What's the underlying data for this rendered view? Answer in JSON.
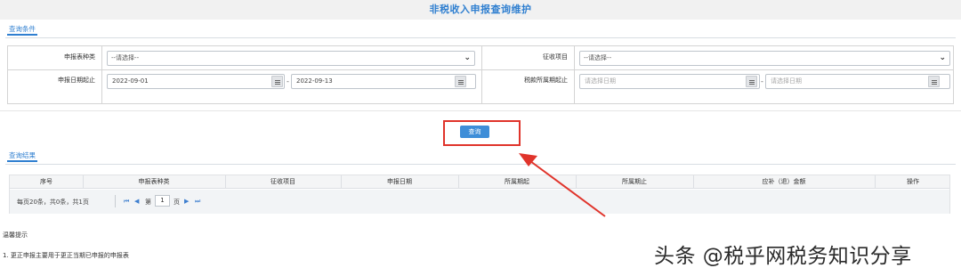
{
  "page": {
    "title": "非税收入申报查询维护"
  },
  "query_section": {
    "tab_label": "查询条件"
  },
  "form": {
    "report_type": {
      "label": "申报表种类",
      "value": "--请选择--"
    },
    "collection_item": {
      "label": "征收项目",
      "value": "--请选择--"
    },
    "report_date": {
      "label": "申报日期起止",
      "start": "2022-09-01",
      "end": "2022-09-13",
      "separator": "-"
    },
    "tax_period": {
      "label": "税款所属期起止",
      "start_placeholder": "请选择日期",
      "end_placeholder": "请选择日期",
      "separator": "-"
    }
  },
  "query_button": {
    "label": "查询"
  },
  "results_section": {
    "tab_label": "查询结果",
    "columns": [
      "序号",
      "申报表种类",
      "征收项目",
      "申报日期",
      "所属期起",
      "所属期止",
      "应补（退）金额",
      "操作"
    ],
    "rows": []
  },
  "pager": {
    "summary": "每页20条，共0条，共1页",
    "page_prefix": "第",
    "current_page": "1",
    "page_suffix": "页",
    "icons": [
      "first-page-icon",
      "prev-page-icon",
      "next-page-icon",
      "last-page-icon"
    ]
  },
  "tips": {
    "title": "温馨提示",
    "items": [
      "1. 更正申报主要用于更正当期已申报的申报表"
    ]
  },
  "watermark": "头条 @税乎网税务知识分享",
  "colors": {
    "accent": "#2f7fd0",
    "button": "#3e8ed8",
    "highlight": "#e0342b"
  }
}
